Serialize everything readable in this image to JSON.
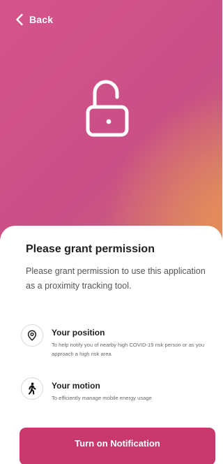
{
  "header": {
    "back_label": "Back",
    "back_icon": "chevron-left-icon",
    "hero_icon": "unlocked-padlock-icon"
  },
  "permission": {
    "title": "Please grant permission",
    "description": "Please grant permission to use this application as a proximity tracking tool.",
    "items": [
      {
        "icon": "location-pin-icon",
        "title": "Your position",
        "description": "To help notify you of nearby high COVID-19 risk person or as you approach a high risk area"
      },
      {
        "icon": "walking-person-icon",
        "title": "Your motion",
        "description": "To efficiently manage mobile energy usage"
      }
    ]
  },
  "cta": {
    "label": "Turn on Notification"
  },
  "colors": {
    "hero_gradient_start": "#d4548a",
    "hero_gradient_end": "#e49058",
    "accent": "#c8386c",
    "text_dark": "#1f1f1f",
    "text_muted": "#555555"
  }
}
